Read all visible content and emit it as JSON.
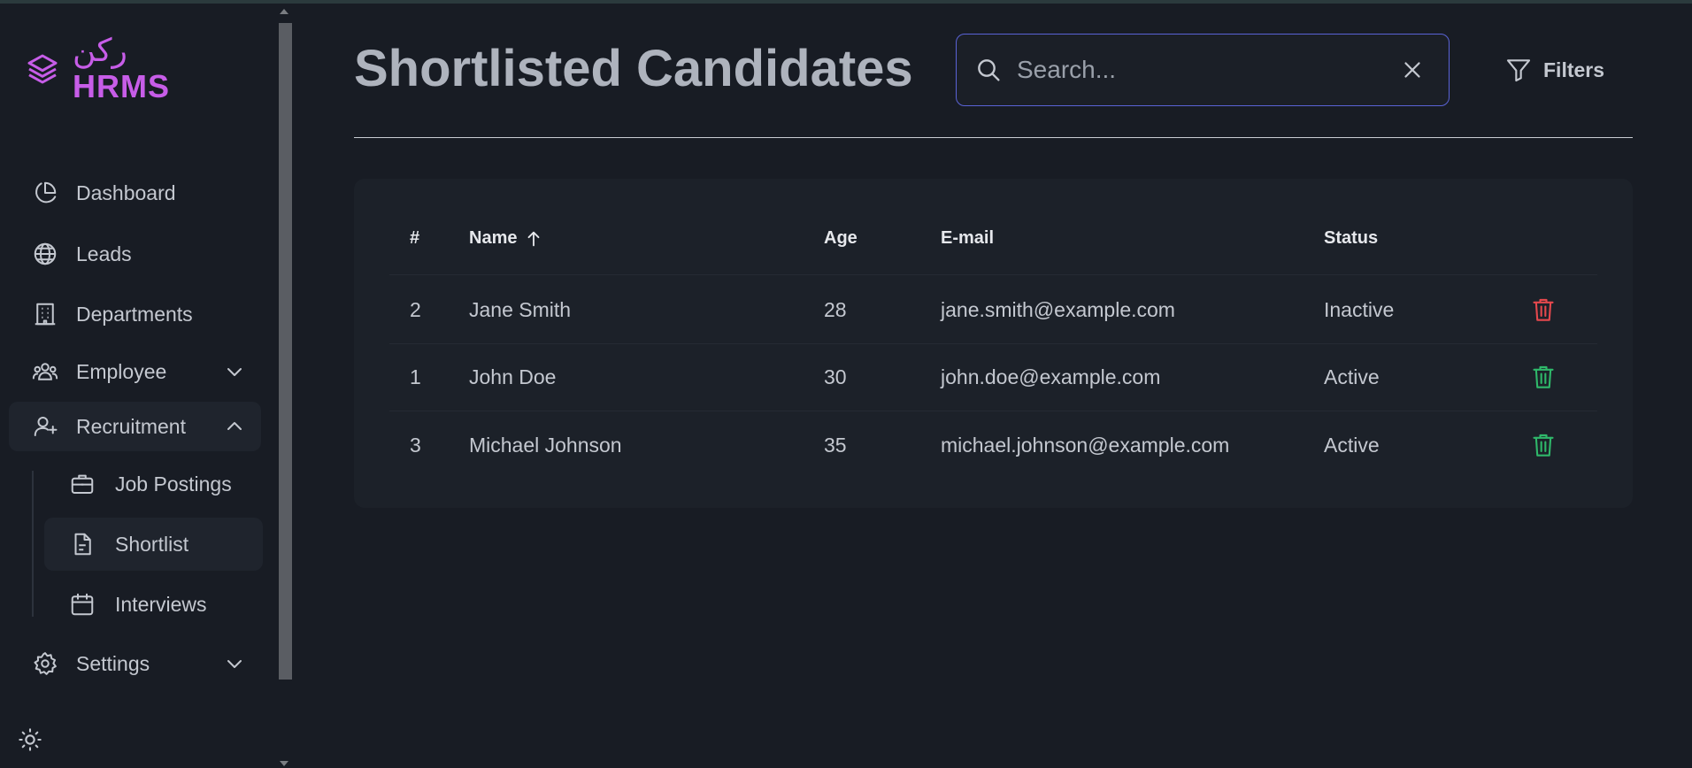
{
  "brand": {
    "arabic": "ركن",
    "name": "HRMS",
    "color": "#c75de8"
  },
  "sidebar": {
    "items": [
      {
        "label": "Dashboard",
        "icon": "pie-chart-icon"
      },
      {
        "label": "Leads",
        "icon": "globe-icon"
      },
      {
        "label": "Departments",
        "icon": "building-icon"
      },
      {
        "label": "Employee",
        "icon": "users-icon",
        "expandable": true,
        "expanded": false
      },
      {
        "label": "Recruitment",
        "icon": "user-plus-icon",
        "expandable": true,
        "expanded": true
      },
      {
        "label": "Settings",
        "icon": "gear-icon",
        "expandable": true,
        "expanded": false
      }
    ],
    "recruitment_children": [
      {
        "label": "Job Postings",
        "icon": "briefcase-icon"
      },
      {
        "label": "Shortlist",
        "icon": "document-icon",
        "active": true
      },
      {
        "label": "Interviews",
        "icon": "calendar-icon"
      }
    ],
    "theme_toggle_icon": "sun-icon"
  },
  "header": {
    "title": "Shortlisted Candidates",
    "search": {
      "placeholder": "Search...",
      "value": ""
    },
    "filters_label": "Filters",
    "accent": "#5a63d6"
  },
  "table": {
    "columns": [
      "#",
      "Name",
      "Age",
      "E-mail",
      "Status"
    ],
    "sort": {
      "column": "Name",
      "direction": "asc"
    },
    "rows": [
      {
        "id": "2",
        "name": "Jane Smith",
        "age": "28",
        "email": "jane.smith@example.com",
        "status": "Inactive",
        "action_color": "#e5484d"
      },
      {
        "id": "1",
        "name": "John Doe",
        "age": "30",
        "email": "john.doe@example.com",
        "status": "Active",
        "action_color": "#2fb86a"
      },
      {
        "id": "3",
        "name": "Michael Johnson",
        "age": "35",
        "email": "michael.johnson@example.com",
        "status": "Active",
        "action_color": "#2fb86a"
      }
    ]
  }
}
